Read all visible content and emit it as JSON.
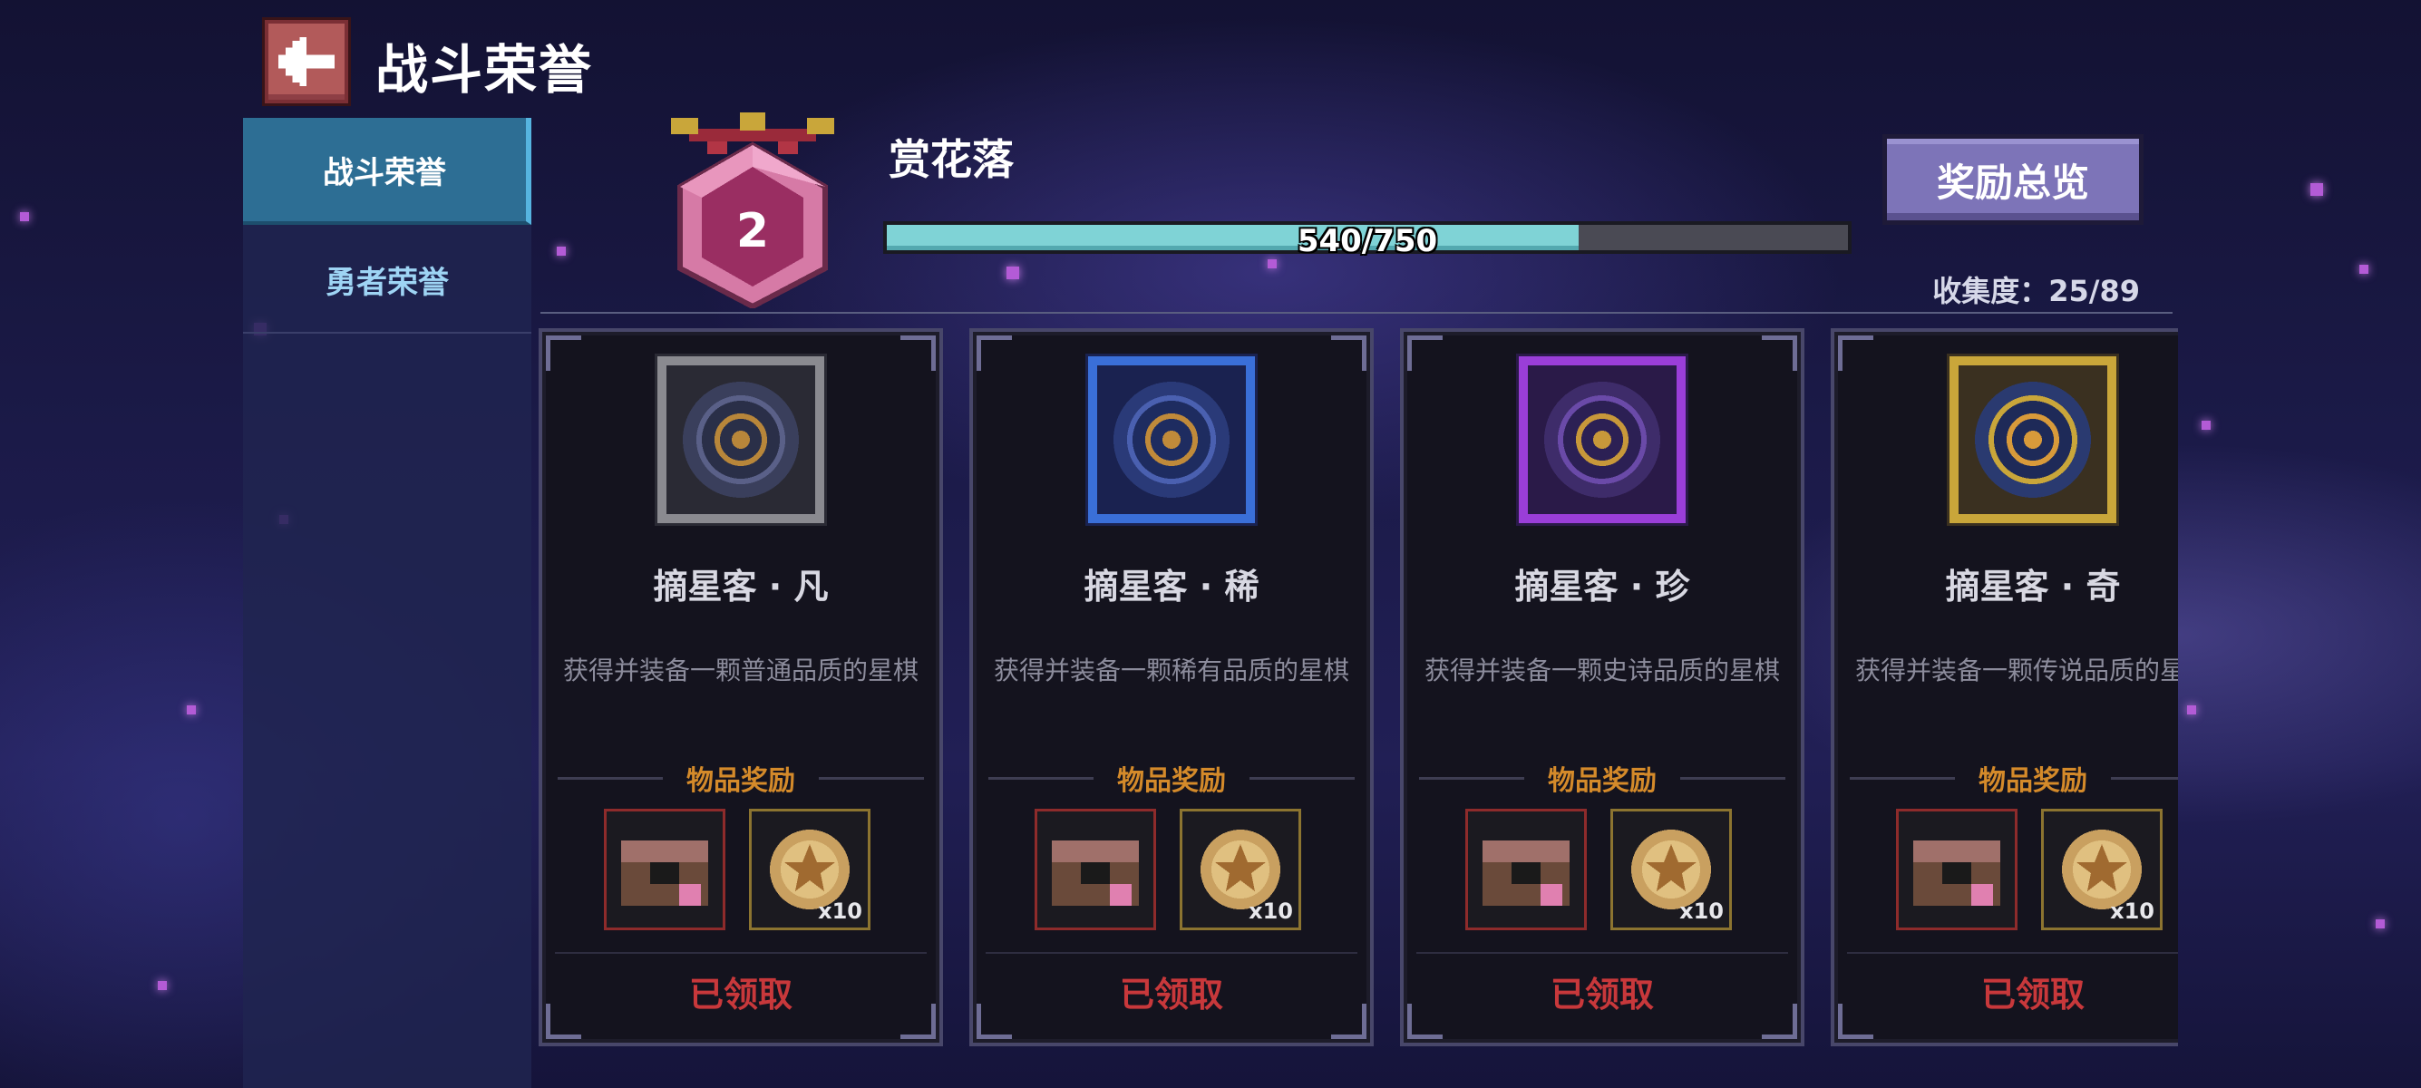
{
  "header": {
    "title": "战斗荣誉"
  },
  "sidebar": {
    "tabs": [
      {
        "label": "战斗荣誉",
        "active": true
      },
      {
        "label": "勇者荣誉",
        "active": false
      }
    ]
  },
  "honor": {
    "level": "2",
    "name": "赏花落",
    "progress_text": "540/750",
    "progress_fraction": 0.72,
    "overview_button": "奖励总览",
    "collection_text": "收集度：25/89"
  },
  "cards": [
    {
      "title": "摘星客 · 凡",
      "desc": "获得并装备一颗普通品质的星棋",
      "reward_label": "物品奖励",
      "qty": "x10",
      "status": "已领取",
      "frame_color": "#8a8a90",
      "icon": "gray-star-chess-icon"
    },
    {
      "title": "摘星客 · 稀",
      "desc": "获得并装备一颗稀有品质的星棋",
      "reward_label": "物品奖励",
      "qty": "x10",
      "status": "已领取",
      "frame_color": "#3a6fd8",
      "icon": "blue-star-chess-icon"
    },
    {
      "title": "摘星客 · 珍",
      "desc": "获得并装备一颗史诗品质的星棋",
      "reward_label": "物品奖励",
      "qty": "x10",
      "status": "已领取",
      "frame_color": "#9a3ed8",
      "icon": "purple-star-chess-icon"
    },
    {
      "title": "摘星客 · 奇",
      "desc": "获得并装备一颗传说品质的星棋",
      "reward_label": "物品奖励",
      "qty": "x10",
      "status": "已领取",
      "frame_color": "#c9a63a",
      "icon": "gold-star-chess-icon"
    }
  ]
}
